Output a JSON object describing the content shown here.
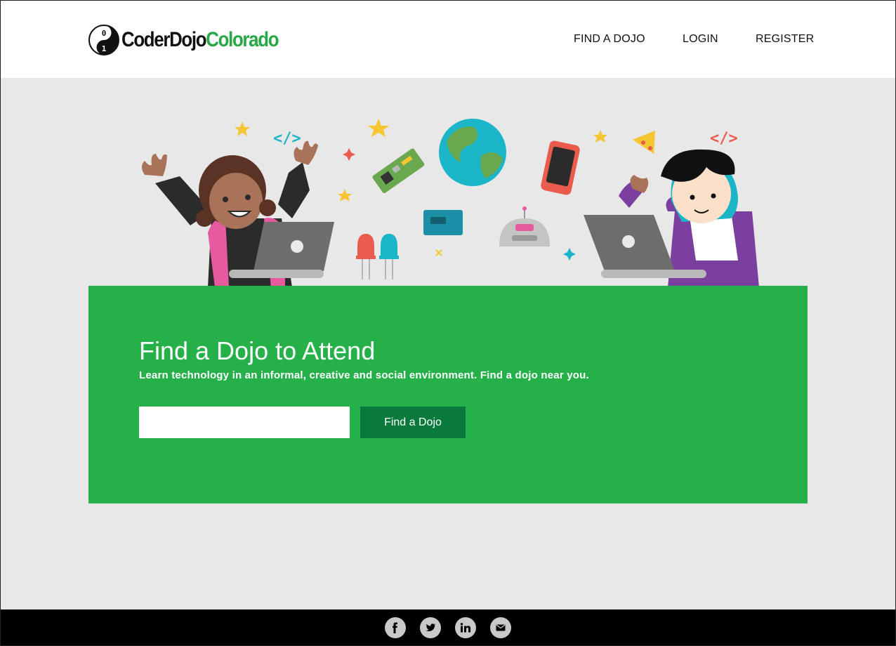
{
  "brand": {
    "name_part1": "CoderDojo",
    "name_part2": "Colorado",
    "logo_glyph_top": "0",
    "logo_glyph_bottom": "1",
    "colors": {
      "green": "#28a745",
      "panel": "#25b04a",
      "button": "#0a7a3c"
    }
  },
  "nav": {
    "find": "FIND A DOJO",
    "login": "LOGIN",
    "register": "REGISTER"
  },
  "hero": {
    "illustration": "kids-coding-illustration"
  },
  "search": {
    "title": "Find a Dojo to Attend",
    "subtitle": "Learn technology in an informal, creative and social environment. Find a dojo near you.",
    "input_value": "",
    "input_placeholder": "",
    "button_label": "Find a Dojo"
  },
  "footer": {
    "icons": [
      "facebook-icon",
      "twitter-icon",
      "linkedin-icon",
      "email-icon"
    ]
  }
}
